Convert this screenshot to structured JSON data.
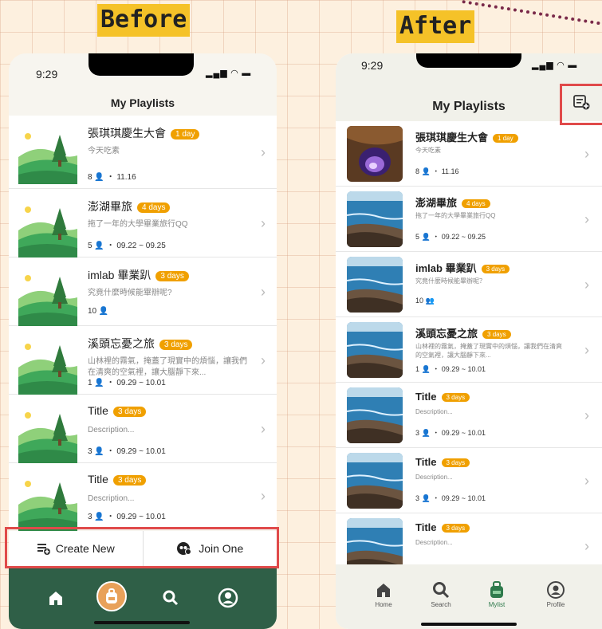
{
  "before_label": "Before",
  "after_label": "After",
  "before": {
    "status_time": "9:29",
    "title": "My Playlists",
    "items": [
      {
        "name": "張琪琪慶生大會",
        "badge": "1 day",
        "desc": "今天吃素",
        "meta": "8 👤 ・ 11.16"
      },
      {
        "name": "澎湖畢旅",
        "badge": "4 days",
        "desc": "拖了一年的大學畢業旅行QQ",
        "meta": "5 👤 ・ 09.22 ~ 09.25"
      },
      {
        "name": "imlab 畢業趴",
        "badge": "3 days",
        "desc": "究竟什麼時候能畢辦呢?",
        "meta": "10 👤"
      },
      {
        "name": "溪頭忘憂之旅",
        "badge": "3 days",
        "desc": "山林裡的霧氣，掩蓋了現實中的煩惱，讓我們在清爽的空氣裡，讓大腦靜下來...",
        "meta": "1 👤 ・ 09.29 ~ 10.01"
      },
      {
        "name": "Title",
        "badge": "3 days",
        "desc": "Description...",
        "meta": "3 👤 ・ 09.29 ~ 10.01"
      },
      {
        "name": "Title",
        "badge": "3 days",
        "desc": "Description...",
        "meta": "3 👤 ・ 09.29 ~ 10.01"
      }
    ],
    "create_label": "Create New",
    "join_label": "Join One"
  },
  "after": {
    "status_time": "9:29",
    "title": "My Playlists",
    "items": [
      {
        "name": "張琪琪慶生大會",
        "badge": "1 day",
        "desc": "今天吃素",
        "meta": "8 👤 ・ 11.16"
      },
      {
        "name": "澎湖畢旅",
        "badge": "4 days",
        "desc": "拖了一年的大學畢業旅行QQ",
        "meta": "5 👤 ・ 09.22 ~ 09.25"
      },
      {
        "name": "imlab 畢業趴",
        "badge": "3 days",
        "desc": "究竟什麼時候能畢辦呢？",
        "meta": "10 👥"
      },
      {
        "name": "溪頭忘憂之旅",
        "badge": "3 days",
        "desc": "山林裡的霧氣，掩蓋了現實中的煩惱，讓我們在清爽的空氣裡，讓大腦靜下來...",
        "meta": "1 👤 ・ 09.29 ~ 10.01"
      },
      {
        "name": "Title",
        "badge": "3 days",
        "desc": "Description...",
        "meta": "3 👤 ・ 09.29 ~ 10.01"
      },
      {
        "name": "Title",
        "badge": "3 days",
        "desc": "Description...",
        "meta": "3 👤 ・ 09.29 ~ 10.01"
      },
      {
        "name": "Title",
        "badge": "3 days",
        "desc": "Description...",
        "meta": ""
      }
    ],
    "nav": [
      {
        "label": "Home",
        "icon": "home-icon"
      },
      {
        "label": "Search",
        "icon": "search-icon"
      },
      {
        "label": "Mylist",
        "icon": "backpack-icon"
      },
      {
        "label": "Profile",
        "icon": "profile-icon"
      }
    ]
  },
  "colors": {
    "accent": "#f0a000",
    "nav_green": "#2f5f47",
    "highlight": "#e04a4a",
    "header_bg": "#f1f1ea",
    "mylist_active": "#2f7a4c"
  }
}
